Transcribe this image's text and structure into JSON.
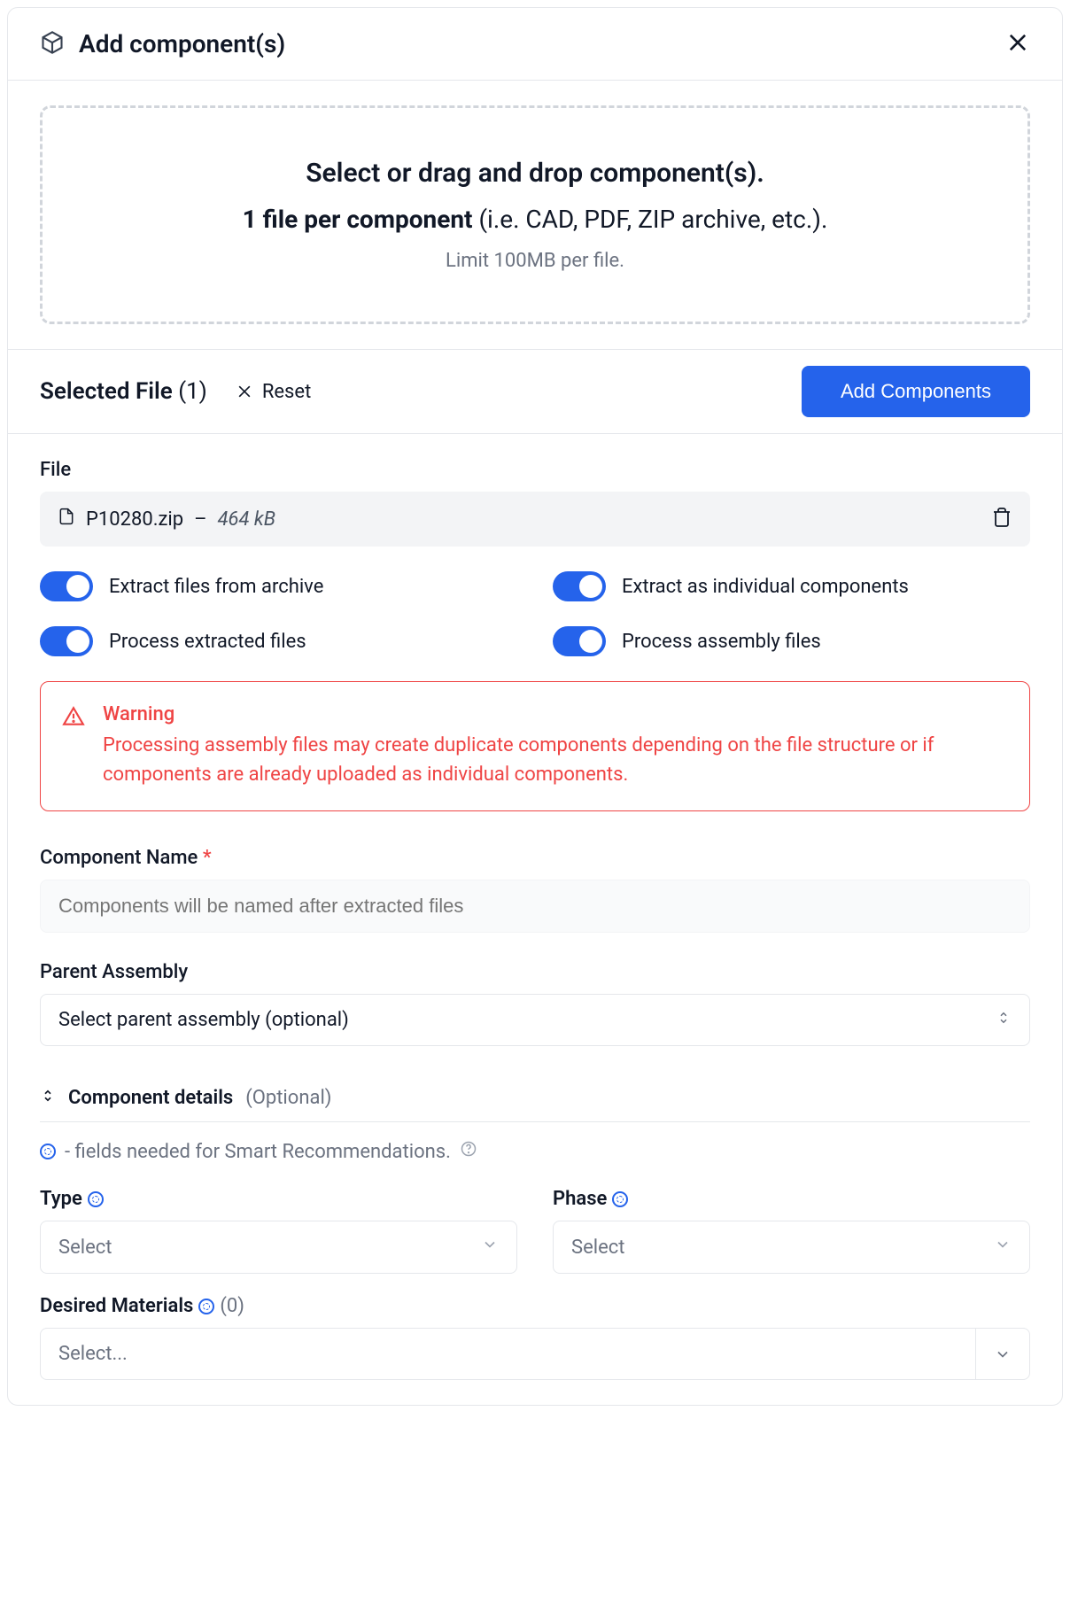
{
  "header": {
    "title": "Add component(s)"
  },
  "dropzone": {
    "line1": "Select or drag and drop component(s).",
    "line2_bold": "1 file per component",
    "line2_rest": " (i.e. CAD, PDF, ZIP archive, etc.).",
    "limit": "Limit 100MB per file."
  },
  "selected": {
    "title": "Selected File",
    "count": "(1)",
    "reset": "Reset",
    "add_button": "Add Components"
  },
  "file": {
    "label": "File",
    "name": "P10280.zip",
    "size": "464 kB"
  },
  "toggles": {
    "extract_archive": "Extract files from archive",
    "extract_individual": "Extract as individual components",
    "process_extracted": "Process extracted files",
    "process_assembly": "Process assembly files"
  },
  "warning": {
    "title": "Warning",
    "text": "Processing assembly files may create duplicate components depending on the file structure or if components are already uploaded as individual components."
  },
  "component_name": {
    "label": "Component Name",
    "placeholder": "Components will be named after extracted files"
  },
  "parent_assembly": {
    "label": "Parent Assembly",
    "placeholder": "Select parent assembly (optional)"
  },
  "details": {
    "title": "Component details",
    "optional": "(Optional)"
  },
  "smart_note": " -  fields needed for Smart Recommendations.",
  "type": {
    "label": "Type",
    "placeholder": "Select"
  },
  "phase": {
    "label": "Phase",
    "placeholder": "Select"
  },
  "materials": {
    "label": "Desired Materials",
    "count": "(0)",
    "placeholder": "Select..."
  }
}
